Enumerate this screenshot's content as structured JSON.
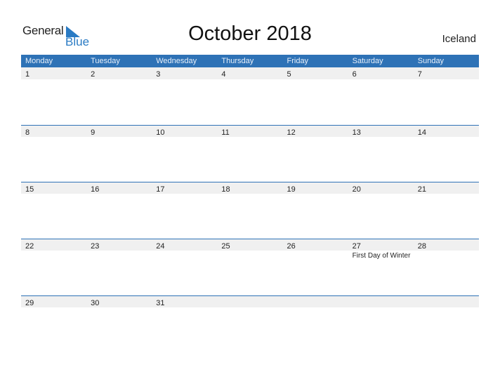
{
  "brand": {
    "line1": "General",
    "line2": "Blue",
    "accent": "#2a7bc4"
  },
  "title": "October 2018",
  "country": "Iceland",
  "colors": {
    "header_bg": "#2e72b6",
    "day_strip_bg": "#f0f0f0"
  },
  "weekdays": [
    "Monday",
    "Tuesday",
    "Wednesday",
    "Thursday",
    "Friday",
    "Saturday",
    "Sunday"
  ],
  "weeks": [
    [
      {
        "day": "1"
      },
      {
        "day": "2"
      },
      {
        "day": "3"
      },
      {
        "day": "4"
      },
      {
        "day": "5"
      },
      {
        "day": "6"
      },
      {
        "day": "7"
      }
    ],
    [
      {
        "day": "8"
      },
      {
        "day": "9"
      },
      {
        "day": "10"
      },
      {
        "day": "11"
      },
      {
        "day": "12"
      },
      {
        "day": "13"
      },
      {
        "day": "14"
      }
    ],
    [
      {
        "day": "15"
      },
      {
        "day": "16"
      },
      {
        "day": "17"
      },
      {
        "day": "18"
      },
      {
        "day": "19"
      },
      {
        "day": "20"
      },
      {
        "day": "21"
      }
    ],
    [
      {
        "day": "22"
      },
      {
        "day": "23"
      },
      {
        "day": "24"
      },
      {
        "day": "25"
      },
      {
        "day": "26"
      },
      {
        "day": "27",
        "event": "First Day of Winter"
      },
      {
        "day": "28"
      }
    ],
    [
      {
        "day": "29"
      },
      {
        "day": "30"
      },
      {
        "day": "31"
      },
      {
        "day": ""
      },
      {
        "day": ""
      },
      {
        "day": ""
      },
      {
        "day": ""
      }
    ]
  ]
}
